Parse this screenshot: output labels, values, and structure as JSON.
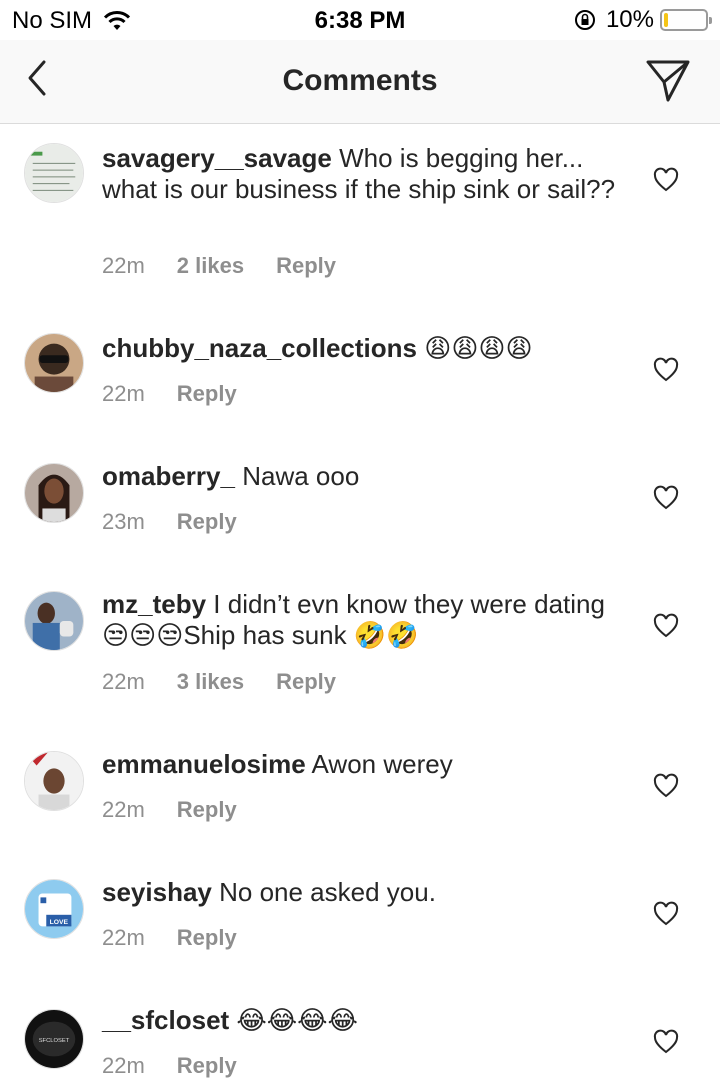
{
  "status": {
    "carrier": "No SIM",
    "time": "6:38 PM",
    "battery": "10%",
    "battery_level": 0.1
  },
  "header": {
    "title": "Comments"
  },
  "actions": {
    "reply": "Reply"
  },
  "comments": [
    {
      "user": "savagery__savage",
      "text": "Who is begging her... what is our business if the ship sink or sail??",
      "time": "22m",
      "likes": "2 likes"
    },
    {
      "user": "chubby_naza_collections",
      "text": "😩😩😩😩",
      "time": "22m",
      "likes": ""
    },
    {
      "user": "omaberry_",
      "text": "Nawa ooo",
      "time": "23m",
      "likes": ""
    },
    {
      "user": "mz_teby",
      "text": "I didn’t evn know they were dating 😒😒😒Ship has sunk 🤣🤣",
      "time": "22m",
      "likes": "3 likes"
    },
    {
      "user": "emmanuelosime",
      "text": "Awon werey",
      "time": "22m",
      "likes": ""
    },
    {
      "user": "seyishay",
      "text": "No one asked you.",
      "time": "22m",
      "likes": ""
    },
    {
      "user": "__sfcloset",
      "text": "😂😂😂😂",
      "time": "22m",
      "likes": ""
    }
  ],
  "avatar_badges": {
    "seyishay": "LOVE",
    "sfcloset": "SFCLOSET"
  }
}
